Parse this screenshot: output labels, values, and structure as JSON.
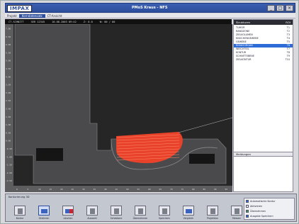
{
  "window": {
    "logo": "IMPAX",
    "title": "PMoS Kraus - NFS",
    "buttons": [
      "_",
      "□",
      "×"
    ]
  },
  "menubar": {
    "items": [
      "Projekt",
      "Kerndatensatz",
      "CT-Ansicht"
    ],
    "selected_index": 1
  },
  "status": {
    "fields": [
      "CT-SCHNITT",
      "SER 12345",
      "10.08.2003 09:42",
      "Z: 0.0",
      "W: 00 / 00"
    ]
  },
  "sidepanel": {
    "header_left": "Strukturen",
    "header_right": "ROI",
    "layers": [
      {
        "name": "TUMOR",
        "code": "T1"
      },
      {
        "name": "RANDZONE",
        "code": "T2"
      },
      {
        "name": "ZIELVOLUMEN",
        "code": "T3"
      },
      {
        "name": "KNOCHENGEWEBE",
        "code": "T4"
      },
      {
        "name": "GEWEBE",
        "code": "T5"
      },
      {
        "name": "RISIKOORGAN",
        "code": "T6"
      },
      {
        "name": "WEICHTEIL",
        "code": "T7"
      },
      {
        "name": "KONTUR",
        "code": "T8"
      },
      {
        "name": "SCHNITTEBENE",
        "code": "T9"
      },
      {
        "name": "ZIELKONTUR",
        "code": "T10"
      }
    ],
    "selected_index": 5,
    "messages_label": "Meldungen"
  },
  "toolbar": {
    "group_label": "Konturierung 3D",
    "tools": [
      {
        "label": "Kontur",
        "icon": "contour-icon",
        "style": "gray"
      },
      {
        "label": "Zeichnen",
        "icon": "draw-icon",
        "style": "blue"
      },
      {
        "label": "Löschen",
        "icon": "delete-icon",
        "style": "mixed"
      },
      {
        "label": "Auswahl",
        "icon": "select-icon",
        "style": "gray"
      },
      {
        "label": "Schablone",
        "icon": "template-icon",
        "style": "gray"
      },
      {
        "label": "Übernehmen",
        "icon": "apply-icon",
        "style": "gray"
      },
      {
        "label": "Speichern",
        "icon": "save-icon",
        "style": "gray"
      },
      {
        "label": "Vergleich",
        "icon": "compare-icon",
        "style": "blue"
      },
      {
        "label": "Projektion",
        "icon": "projection-icon",
        "style": "gray"
      },
      {
        "label": "Messen",
        "icon": "measure-icon",
        "style": "gray"
      }
    ],
    "active_index": 1
  },
  "info": {
    "rows": [
      {
        "text": "Automatische Kontur",
        "dot": "b"
      },
      {
        "text": "Aktivieren",
        "dot": "none"
      },
      {
        "text": "Übernehmen",
        "dot": "g"
      },
      {
        "text": "Ausgabe Speichern",
        "dot": "b"
      }
    ]
  },
  "canvas": {
    "y_ticks": [
      "7.00",
      "6.50",
      "6.00",
      "5.50",
      "5.00",
      "4.50",
      "4.00",
      "3.50",
      "3.00",
      "2.50",
      "2.00",
      "1.50",
      "1.00",
      "0.50",
      "0.00",
      "-0.50",
      "-1.00",
      "-1.50",
      "-2.00",
      "-2.50"
    ],
    "x_ticks": [
      "0",
      "5",
      "10",
      "15",
      "20",
      "25",
      "30",
      "35",
      "40",
      "45",
      "50",
      "55",
      "60",
      "65",
      "70",
      "75",
      "80",
      "85",
      "90",
      "95"
    ],
    "highlight_color": "#e8432a",
    "bg_color": "#262626",
    "region_color": "#4a4a4c"
  }
}
